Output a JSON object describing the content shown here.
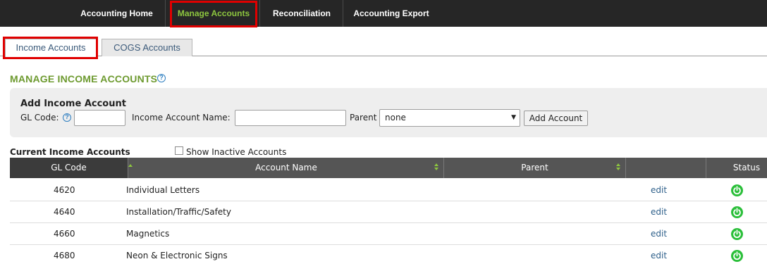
{
  "nav": {
    "items": [
      {
        "label": "Accounting Home"
      },
      {
        "label": "Manage Accounts"
      },
      {
        "label": "Reconciliation"
      },
      {
        "label": "Accounting Export"
      }
    ]
  },
  "tabs": [
    {
      "label": "Income Accounts"
    },
    {
      "label": "COGS Accounts"
    }
  ],
  "page": {
    "title": "MANAGE INCOME ACCOUNTS",
    "help_symbol": "?"
  },
  "add_form": {
    "title": "Add Income Account",
    "gl_code_label": "GL Code:",
    "gl_code_value": "",
    "name_label": "Income Account Name:",
    "name_value": "",
    "parent_label": "Parent",
    "parent_selected": "none",
    "submit_label": "Add Account"
  },
  "current": {
    "title": "Current Income Accounts",
    "show_inactive_label": "Show Inactive Accounts",
    "show_inactive_checked": false
  },
  "table": {
    "columns": [
      {
        "label": "GL Code"
      },
      {
        "label": "Account Name"
      },
      {
        "label": "Parent"
      },
      {
        "label": ""
      },
      {
        "label": "Status"
      }
    ],
    "rows": [
      {
        "gl_code": "4620",
        "name": "Individual Letters",
        "parent": "",
        "action": "edit",
        "status": "active"
      },
      {
        "gl_code": "4640",
        "name": "Installation/Traffic/Safety",
        "parent": "",
        "action": "edit",
        "status": "active"
      },
      {
        "gl_code": "4660",
        "name": "Magnetics",
        "parent": "",
        "action": "edit",
        "status": "active"
      },
      {
        "gl_code": "4680",
        "name": "Neon & Electronic Signs",
        "parent": "",
        "action": "edit",
        "status": "active"
      }
    ]
  },
  "colors": {
    "nav_bg": "#262626",
    "accent_green": "#8dc63f",
    "title_green": "#6d9a2f",
    "highlight_red": "#e00000",
    "status_green": "#2bbf3a"
  },
  "icons": {
    "help": "help-circle-icon",
    "status": "power-icon",
    "sort": "sort-arrows-icon",
    "dropdown": "caret-down-icon"
  }
}
